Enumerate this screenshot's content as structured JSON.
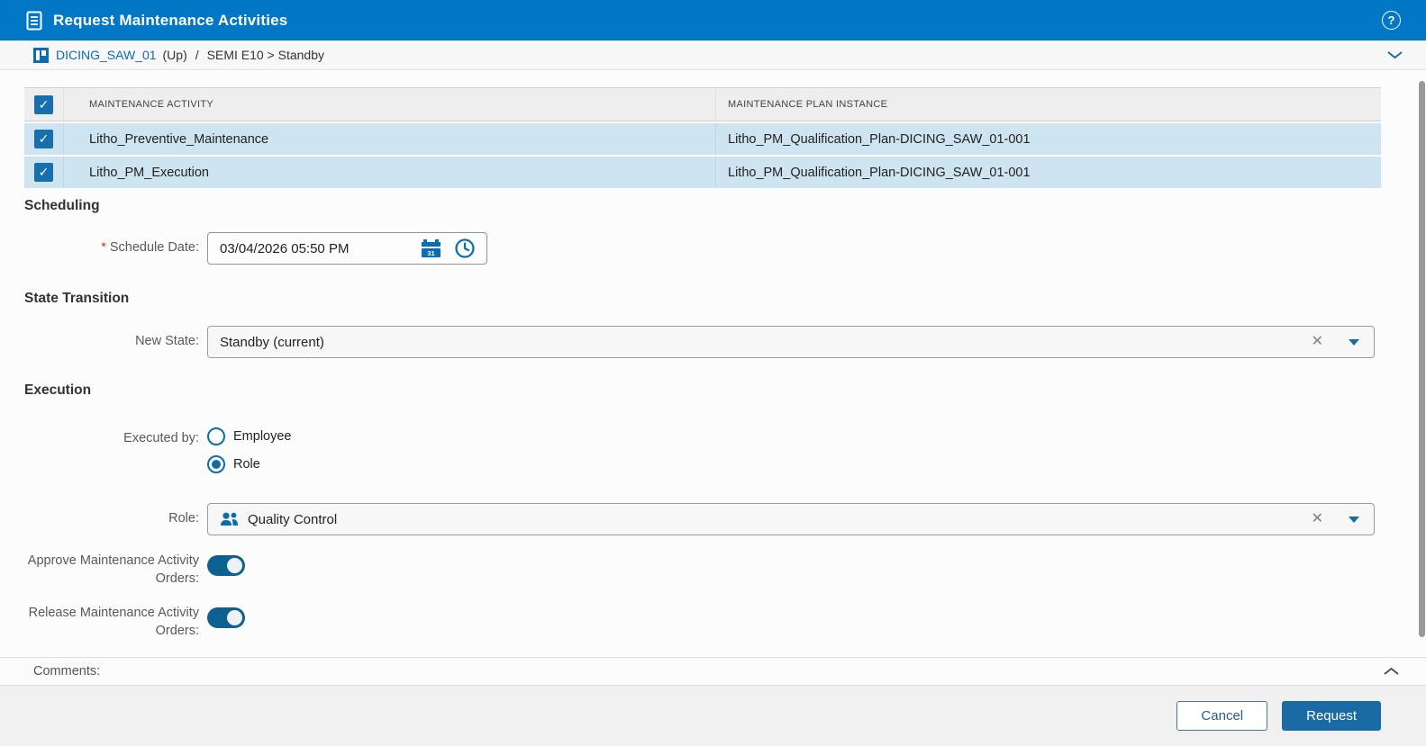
{
  "header": {
    "title": "Request Maintenance Activities"
  },
  "breadcrumb": {
    "entity": "DICING_SAW_01",
    "up_label": "(Up)",
    "separator": "/",
    "path": "SEMI E10 > Standby"
  },
  "table": {
    "columns": [
      "MAINTENANCE ACTIVITY",
      "MAINTENANCE PLAN INSTANCE"
    ],
    "select_all_checked": true,
    "rows": [
      {
        "activity": "Litho_Preventive_Maintenance",
        "plan_instance": "Litho_PM_Qualification_Plan-DICING_SAW_01-001",
        "checked": true
      },
      {
        "activity": "Litho_PM_Execution",
        "plan_instance": "Litho_PM_Qualification_Plan-DICING_SAW_01-001",
        "checked": true
      }
    ]
  },
  "scheduling": {
    "section_title": "Scheduling",
    "required_marker": "*",
    "schedule_date_label": "Schedule Date:",
    "schedule_date_value": "03/04/2026 05:50 PM"
  },
  "state_transition": {
    "section_title": "State Transition",
    "new_state_label": "New State:",
    "new_state_value": "Standby (current)"
  },
  "execution": {
    "section_title": "Execution",
    "executed_by_label": "Executed by:",
    "options": [
      {
        "label": "Employee",
        "selected": false
      },
      {
        "label": "Role",
        "selected": true
      }
    ],
    "role_label": "Role:",
    "role_value": "Quality Control",
    "approve_label": "Approve Maintenance Activity Orders:",
    "approve_on": true,
    "release_label": "Release Maintenance Activity Orders:",
    "release_on": true
  },
  "comments": {
    "label": "Comments:"
  },
  "footer": {
    "cancel_label": "Cancel",
    "request_label": "Request"
  },
  "icons": {
    "help": "?",
    "clear": "✕",
    "check": "✓"
  },
  "colors": {
    "header_bg": "#0277c6",
    "accent_blue": "#0b6db4",
    "checkbox_blue": "#176fae",
    "toggle_on": "#0d6191",
    "selected_row_bg": "#cfe4f1",
    "primary_button_bg": "#1a6ba3"
  }
}
